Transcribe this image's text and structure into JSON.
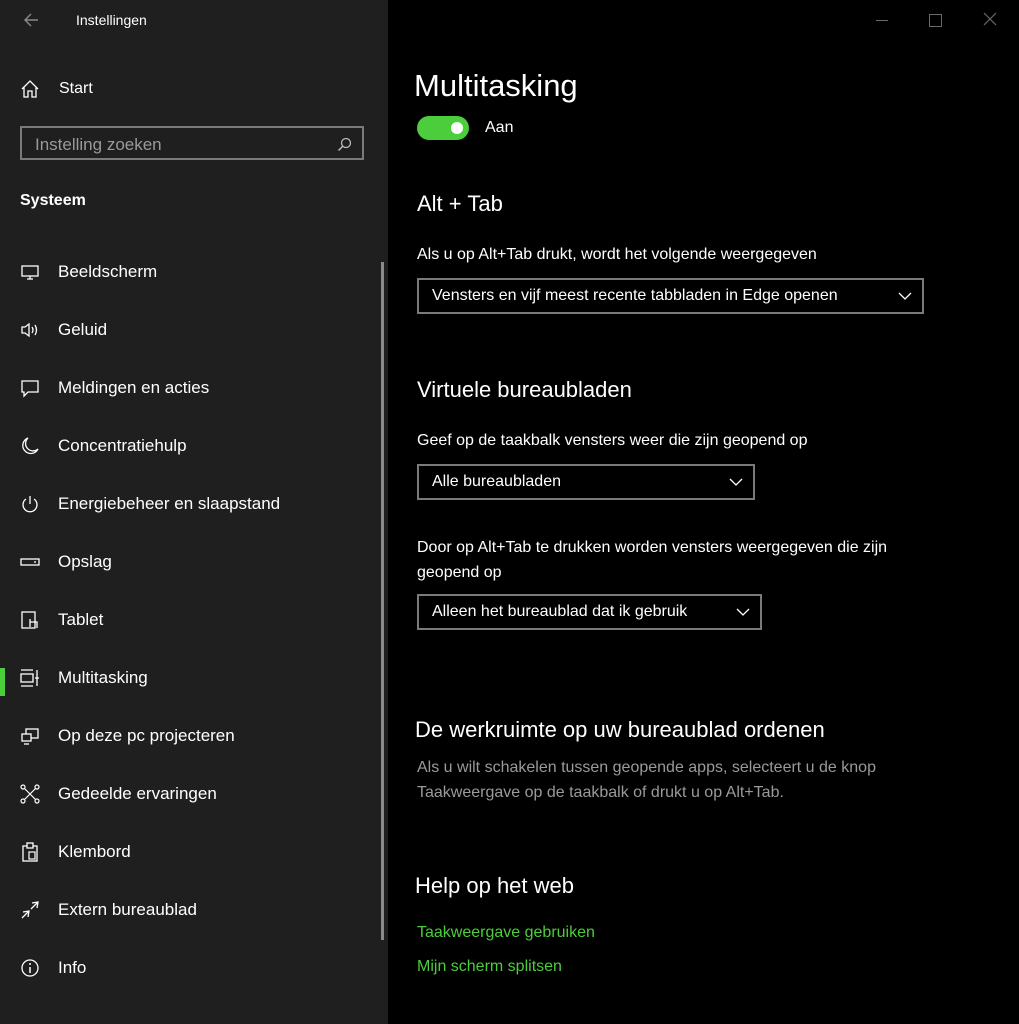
{
  "window": {
    "title": "Instellingen"
  },
  "sidebar": {
    "start_label": "Start",
    "search": {
      "placeholder": "Instelling zoeken"
    },
    "section": "Systeem",
    "items": [
      {
        "label": "Beeldscherm",
        "icon": "monitor-icon"
      },
      {
        "label": "Geluid",
        "icon": "speaker-icon"
      },
      {
        "label": "Meldingen en acties",
        "icon": "notification-icon"
      },
      {
        "label": "Concentratiehulp",
        "icon": "moon-icon"
      },
      {
        "label": "Energiebeheer en slaapstand",
        "icon": "power-icon"
      },
      {
        "label": "Opslag",
        "icon": "storage-icon"
      },
      {
        "label": "Tablet",
        "icon": "tablet-icon"
      },
      {
        "label": "Multitasking",
        "icon": "multitasking-icon",
        "active": true
      },
      {
        "label": "Op deze pc projecteren",
        "icon": "project-icon"
      },
      {
        "label": "Gedeelde ervaringen",
        "icon": "shared-icon"
      },
      {
        "label": "Klembord",
        "icon": "clipboard-icon"
      },
      {
        "label": "Extern bureaublad",
        "icon": "remote-desktop-icon"
      },
      {
        "label": "Info",
        "icon": "info-icon"
      }
    ]
  },
  "main": {
    "title": "Multitasking",
    "toggle": {
      "state": "on",
      "label": "Aan"
    },
    "alt_tab": {
      "heading": "Alt + Tab",
      "description": "Als u op Alt+Tab drukt, wordt het volgende weergegeven",
      "selected": "Vensters en vijf meest recente tabbladen in Edge openen"
    },
    "virtual": {
      "heading": "Virtuele bureaubladen",
      "taskbar_description": "Geef op de taakbalk vensters weer die zijn geopend op",
      "taskbar_selected": "Alle bureaubladen",
      "alttab_description_line1": "Door op Alt+Tab te drukken worden vensters weergegeven die zijn",
      "alttab_description_line2": "geopend op",
      "alttab_selected": "Alleen het bureaublad dat ik gebruik"
    },
    "organize": {
      "heading": "De werkruimte op uw bureaublad ordenen",
      "text_line1": "Als u wilt schakelen tussen geopende apps, selecteert u de knop",
      "text_line2": "Taakweergave op de taakbalk of drukt u op Alt+Tab."
    },
    "help": {
      "heading": "Help op het web",
      "links": [
        "Taakweergave gebruiken",
        "Mijn scherm splitsen"
      ]
    }
  },
  "colors": {
    "accent": "#4ccd3b",
    "sidebar_bg": "#1f1f1f",
    "main_bg": "#000000"
  }
}
